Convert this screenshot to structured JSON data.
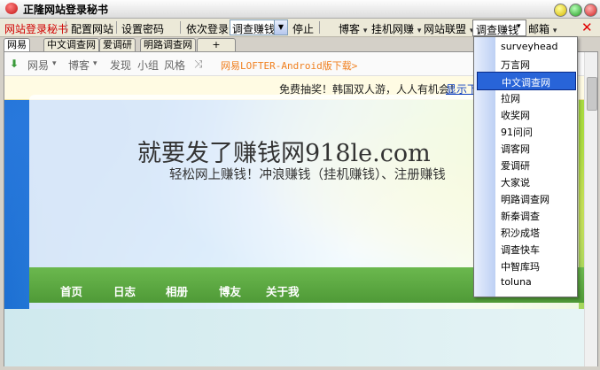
{
  "window": {
    "title": "正隆网站登录秘书"
  },
  "toolbar": {
    "items": [
      "网站登录秘书",
      "配置网站",
      "设置密码",
      "依次登录",
      "停止",
      "博客",
      "挂机网赚",
      "网站联盟",
      "邮箱"
    ],
    "select_value": "调查赚钱",
    "active_menu": "调查赚钱",
    "close_glyph": "✕",
    "dropdown_glyph": "▾"
  },
  "tabs": [
    "网易",
    "中文调查网",
    "爱调研",
    "明路调查网",
    "+"
  ],
  "navbar": {
    "items": [
      "网易",
      "博客",
      "发现",
      "小组",
      "风格"
    ],
    "promo": "网易LOFTER-Android版下载>"
  },
  "banner": {
    "text": "免费抽奖！韩国双人游，人人有机会！",
    "link": "显示下"
  },
  "site": {
    "title": "就要发了赚钱网918le.com",
    "subtitle": "轻松网上赚钱！冲浪赚钱（挂机赚钱）、注册赚钱",
    "nav": [
      "首页",
      "日志",
      "相册",
      "博友",
      "关于我"
    ]
  },
  "dropdown": {
    "items": [
      "surveyhead",
      "万言网",
      "中文调查网",
      "拉网",
      "收奖网",
      "91问问",
      "调客网",
      "爱调研",
      "大家说",
      "明路调查网",
      "新秦调查",
      "积沙成塔",
      "调查快车",
      "中智库玛",
      "toluna"
    ],
    "selected": "中文调查网"
  }
}
